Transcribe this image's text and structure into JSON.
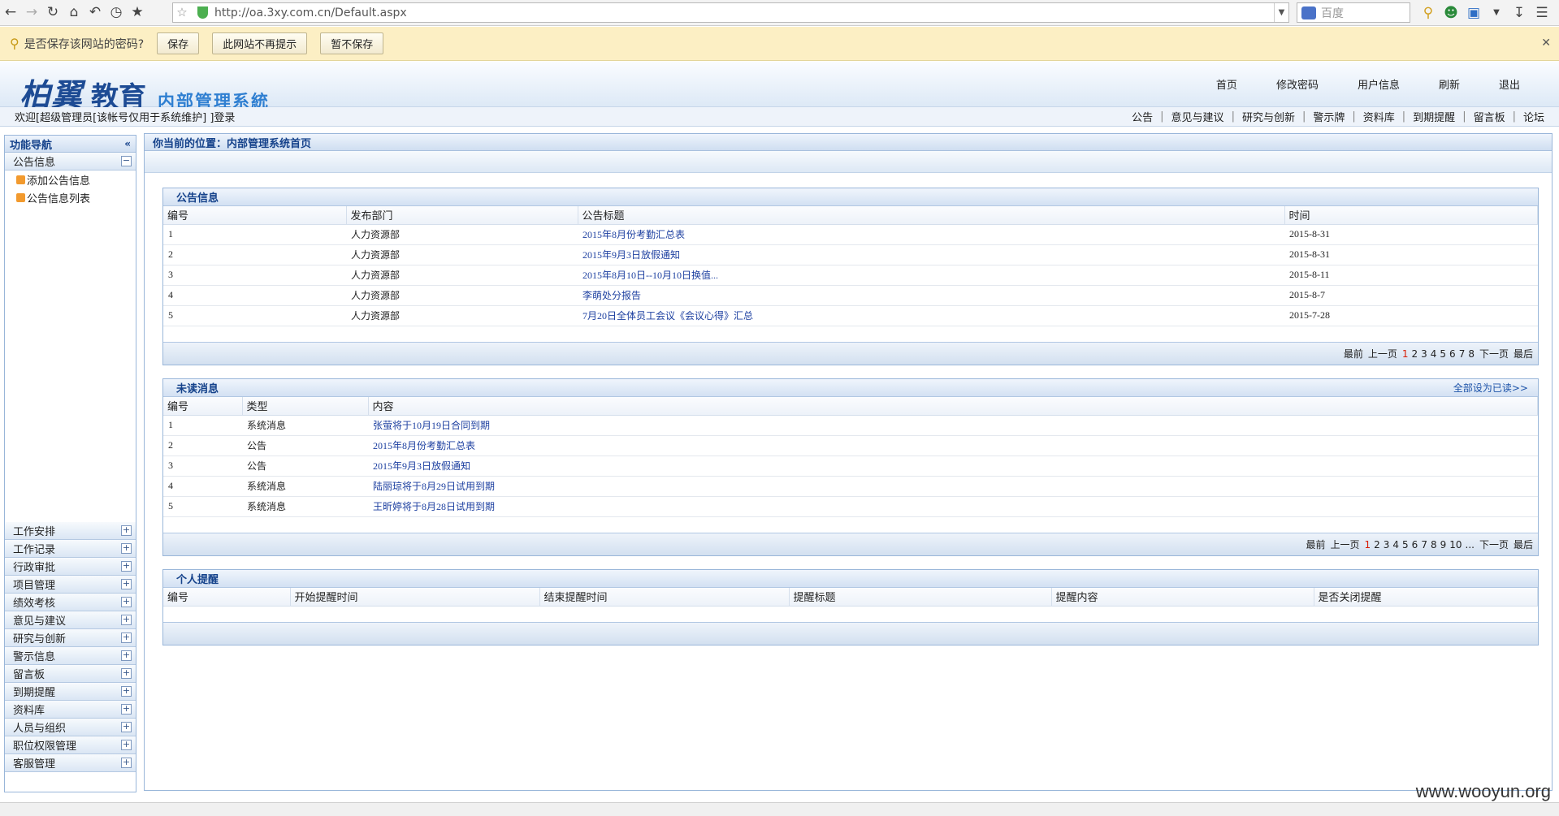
{
  "browser": {
    "url": "http://oa.3xy.com.cn/Default.aspx",
    "search_placeholder": "百度"
  },
  "password_bar": {
    "question": "是否保存该网站的密码?",
    "save": "保存",
    "never": "此网站不再提示",
    "not_now": "暂不保存"
  },
  "header": {
    "brand": "柏翼",
    "edu": "教育",
    "system": "内部管理系統",
    "nav": [
      "首页",
      "修改密码",
      "用户信息",
      "刷新",
      "退出"
    ]
  },
  "subbar": {
    "welcome": "欢迎[超级管理员[该帐号仅用于系统维护] ]登录",
    "links": [
      "公告",
      "意见与建议",
      "研究与创新",
      "警示牌",
      "资料库",
      "到期提醒",
      "留言板",
      "论坛"
    ]
  },
  "sidebar": {
    "title": "功能导航",
    "open_menu": "公告信息",
    "sub_items": [
      "添加公告信息",
      "公告信息列表"
    ],
    "menus": [
      "工作安排",
      "工作记录",
      "行政审批",
      "项目管理",
      "绩效考核",
      "意见与建议",
      "研究与创新",
      "警示信息",
      "留言板",
      "到期提醒",
      "资料库",
      "人员与组织",
      "职位权限管理",
      "客服管理"
    ]
  },
  "breadcrumb": "你当前的位置：内部管理系统首页",
  "announcements": {
    "title": "公告信息",
    "headers": [
      "编号",
      "发布部门",
      "公告标题",
      "时间"
    ],
    "rows": [
      [
        "1",
        "人力资源部",
        "2015年8月份考勤汇总表",
        "2015-8-31"
      ],
      [
        "2",
        "人力资源部",
        "2015年9月3日放假通知",
        "2015-8-31"
      ],
      [
        "3",
        "人力资源部",
        "2015年8月10日--10月10日换值...",
        "2015-8-11"
      ],
      [
        "4",
        "人力资源部",
        "李萌处分报告",
        "2015-8-7"
      ],
      [
        "5",
        "人力资源部",
        "7月20日全体员工会议《会议心得》汇总",
        "2015-7-28"
      ]
    ],
    "pager": {
      "first": "最前",
      "prev": "上一页",
      "current": "1",
      "pages": [
        "2",
        "3",
        "4",
        "5",
        "6",
        "7",
        "8"
      ],
      "next": "下一页",
      "last": "最后"
    }
  },
  "unread": {
    "title": "未读消息",
    "mark_all": "全部设为已读>>",
    "headers": [
      "编号",
      "类型",
      "内容"
    ],
    "rows": [
      [
        "1",
        "系统消息",
        "张萤将于10月19日合同到期"
      ],
      [
        "2",
        "公告",
        "2015年8月份考勤汇总表"
      ],
      [
        "3",
        "公告",
        "2015年9月3日放假通知"
      ],
      [
        "4",
        "系统消息",
        "陆丽琼将于8月29日试用到期"
      ],
      [
        "5",
        "系统消息",
        "王昕婷将于8月28日试用到期"
      ]
    ],
    "pager": {
      "first": "最前",
      "prev": "上一页",
      "current": "1",
      "pages": [
        "2",
        "3",
        "4",
        "5",
        "6",
        "7",
        "8",
        "9",
        "10",
        "..."
      ],
      "next": "下一页",
      "last": "最后"
    }
  },
  "reminders": {
    "title": "个人提醒",
    "headers": [
      "编号",
      "开始提醒时间",
      "结束提醒时间",
      "提醒标题",
      "提醒内容",
      "是否关闭提醒"
    ]
  },
  "watermark": "www.wooyun.org"
}
